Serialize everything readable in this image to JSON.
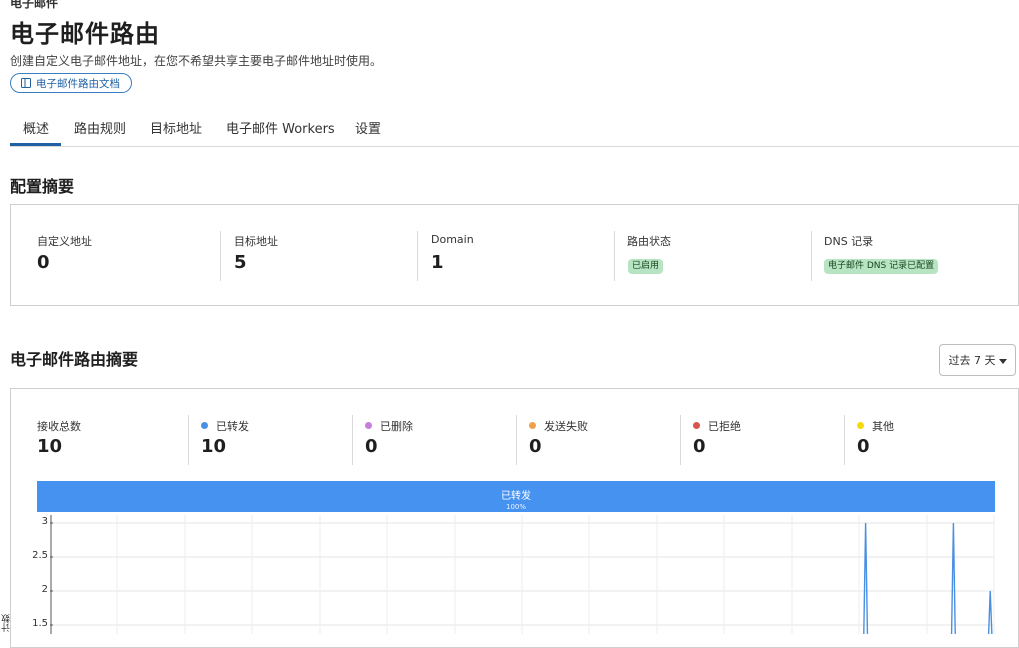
{
  "header": {
    "eyebrow": "电子邮件",
    "title": "电子邮件路由",
    "subtitle": "创建自定义电子邮件地址，在您不希望共享主要电子邮件地址时使用。",
    "docs_button": "电子邮件路由文档"
  },
  "tabs": [
    {
      "label": "概述",
      "active": true
    },
    {
      "label": "路由规则",
      "active": false
    },
    {
      "label": "目标地址",
      "active": false
    },
    {
      "label": "电子邮件 Workers",
      "active": false
    },
    {
      "label": "设置",
      "active": false
    }
  ],
  "config_summary": {
    "title": "配置摘要",
    "stats": [
      {
        "label": "自定义地址",
        "value": "0"
      },
      {
        "label": "目标地址",
        "value": "5"
      },
      {
        "label": "Domain",
        "value": "1"
      },
      {
        "label": "路由状态",
        "badge": "已启用"
      },
      {
        "label": "DNS 记录",
        "badge": "电子邮件 DNS 记录已配置"
      }
    ]
  },
  "routing_summary": {
    "title": "电子邮件路由摘要",
    "range_button": "过去 7 天",
    "stats": [
      {
        "label": "接收总数",
        "value": "10",
        "dot_color": null
      },
      {
        "label": "已转发",
        "value": "10",
        "dot_color": "#4a90e2"
      },
      {
        "label": "已删除",
        "value": "0",
        "dot_color": "#c77ddc"
      },
      {
        "label": "发送失败",
        "value": "0",
        "dot_color": "#f0a04b"
      },
      {
        "label": "已拒绝",
        "value": "0",
        "dot_color": "#d9534f"
      },
      {
        "label": "其他",
        "value": "0",
        "dot_color": "#f5d90a"
      }
    ],
    "distribution_bar": {
      "label": "已转发",
      "percent": "100%",
      "fraction": 1.0,
      "color": "#4692f0"
    }
  },
  "chart_data": {
    "type": "line",
    "ylabel": "计数",
    "y_ticks": [
      "3",
      "2.5",
      "2",
      "1.5"
    ],
    "ylim": [
      1.5,
      3
    ],
    "grid": true,
    "series": [
      {
        "color": "#4a90e2",
        "spikes": [
          {
            "at": 0.864,
            "value": 3
          },
          {
            "at": 0.957,
            "value": 3
          },
          {
            "at": 0.996,
            "value": 2
          }
        ]
      }
    ]
  },
  "icons": {
    "docs": "book-icon",
    "range_caret": "caret-down-icon"
  }
}
